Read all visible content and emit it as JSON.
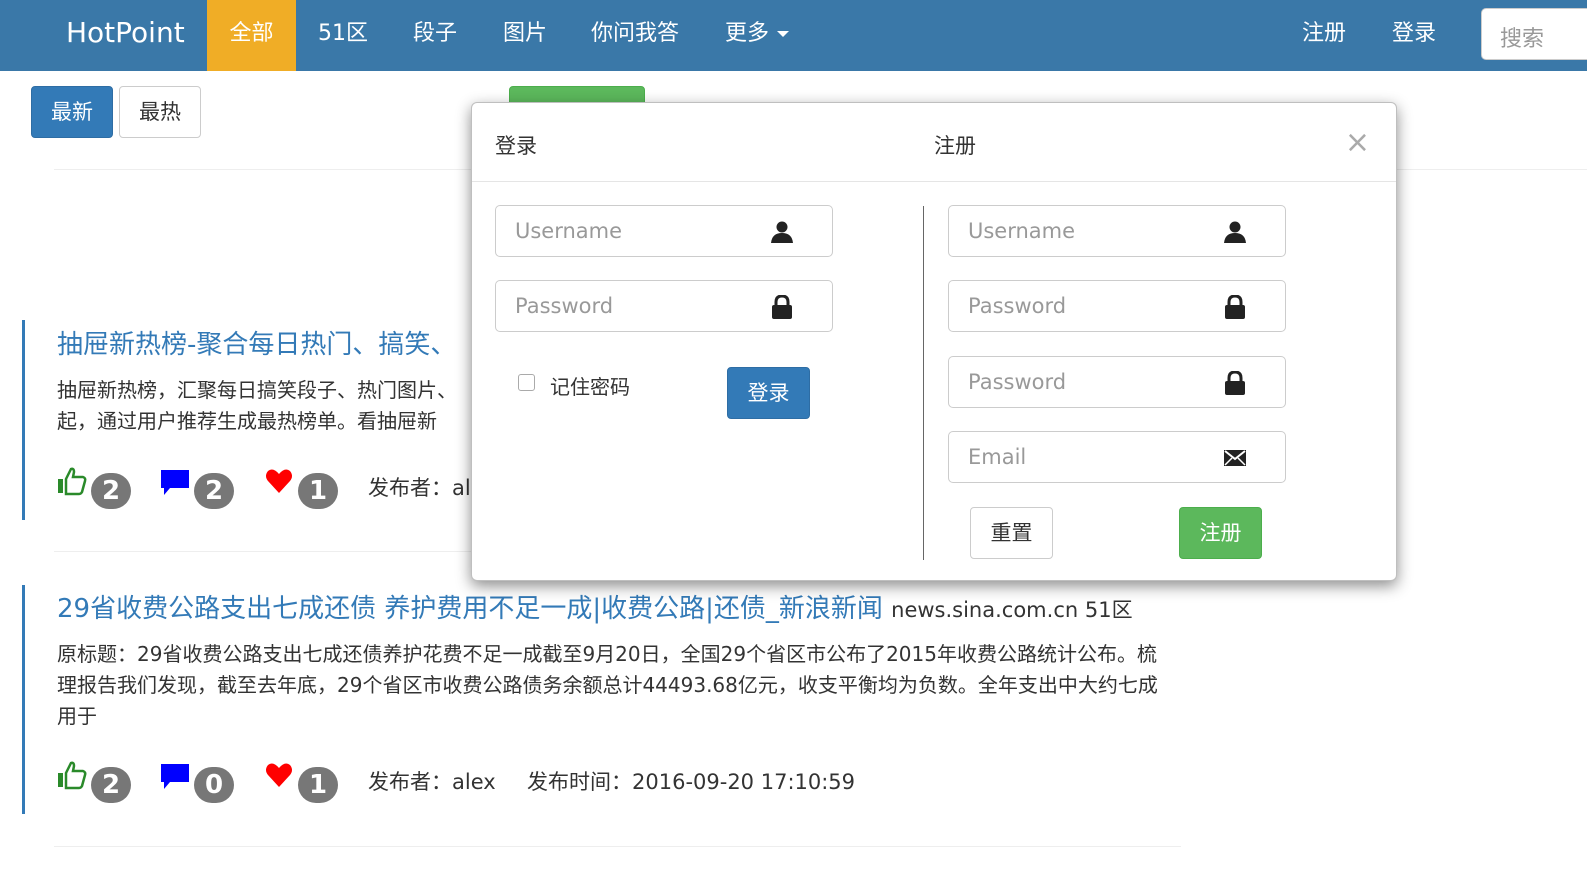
{
  "navbar": {
    "brand": "HotPoint",
    "items": [
      {
        "label": "全部",
        "active": true
      },
      {
        "label": "51区"
      },
      {
        "label": "段子"
      },
      {
        "label": "图片"
      },
      {
        "label": "你问我答"
      },
      {
        "label": "更多"
      }
    ],
    "register": "注册",
    "login": "登录",
    "search_placeholder": "搜索"
  },
  "sort": {
    "latest": "最新",
    "hottest": "最热"
  },
  "articles": [
    {
      "title": "抽屉新热榜-聚合每日热门、搞笑、",
      "body": "抽屉新热榜，汇聚每日搞笑段子、热门图片、起，通过用户推荐生成最热榜单。看抽屉新",
      "body_line1": "抽屉新热榜，汇聚每日搞笑段子、热门图片、",
      "body_line2": "起，通过用户推荐生成最热榜单。看抽屉新",
      "likes": "2",
      "comments": "2",
      "favorites": "1",
      "publisher": "发布者：al"
    },
    {
      "title": "29省收费公路支出七成还债 养护费用不足一成|收费公路|还债_新浪新闻",
      "source": "news.sina.com.cn 51区",
      "body": "原标题：29省收费公路支出七成还债养护花费不足一成截至9月20日，全国29个省区市公布了2015年收费公路统计公布。梳理报告我们发现，截至去年底，29个省区市收费公路债务余额总计44493.68亿元，收支平衡均为负数。全年支出中大约七成用于",
      "likes": "2",
      "comments": "0",
      "favorites": "1",
      "publisher": "发布者：alex",
      "time": "发布时间：2016-09-20 17:10:59"
    }
  ],
  "modal": {
    "login_tab": "登录",
    "register_tab": "注册",
    "close": "×",
    "login": {
      "username_placeholder": "Username",
      "password_placeholder": "Password",
      "remember": "记住密码",
      "submit": "登录"
    },
    "register": {
      "username_placeholder": "Username",
      "password_placeholder": "Password",
      "confirm_placeholder": "Password",
      "email_placeholder": "Email",
      "reset": "重置",
      "submit": "注册"
    }
  },
  "colors": {
    "navbar": "#3a78a8",
    "active": "#f0ad26",
    "primary": "#337ab7",
    "success": "#5cb85c",
    "like": "#2a8a2a",
    "comment": "#0000ff",
    "heart": "#ff0000"
  }
}
